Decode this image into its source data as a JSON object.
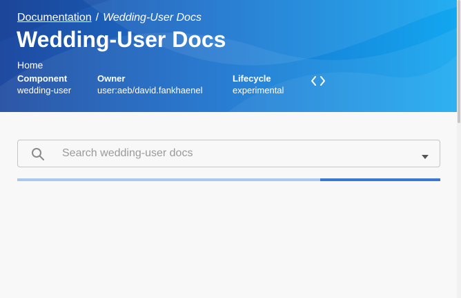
{
  "breadcrumb": {
    "parent": "Documentation",
    "separator": "/",
    "current": "Wedding-User Docs"
  },
  "header": {
    "title": "Wedding-User Docs",
    "subtitle": "Home",
    "metadata": [
      {
        "label": "Component",
        "value": "wedding-user"
      },
      {
        "label": "Owner",
        "value": "user:aeb/david.fankhaenel"
      },
      {
        "label": "Lifecycle",
        "value": "experimental"
      }
    ],
    "code_icon": "code-brackets-icon"
  },
  "search": {
    "placeholder": "Search wedding-user docs",
    "value": "",
    "icon": "search-icon",
    "dropdown_icon": "caret-down-icon"
  },
  "loading": {
    "indeterminate": true
  },
  "colors": {
    "header_start": "#1f4aa0",
    "header_end": "#12a7f0",
    "progress_track": "#a8c9ec",
    "progress_bar": "#3a78d0",
    "background": "#f8f8f8"
  }
}
